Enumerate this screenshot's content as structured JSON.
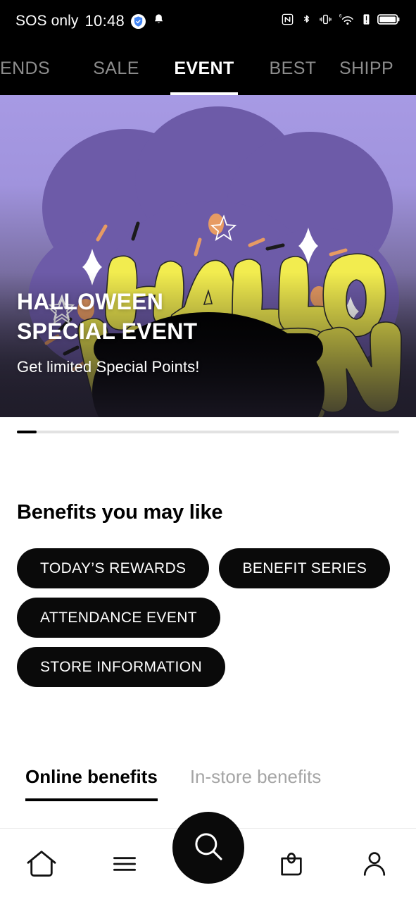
{
  "status_bar": {
    "carrier": "SOS only",
    "time": "10:48",
    "left_icons": [
      "shield-icon",
      "bell-icon"
    ],
    "right_icons": [
      "nfc-icon",
      "bluetooth-icon",
      "vibrate-icon",
      "wifi-6g-icon",
      "signal-alert-icon",
      "battery-icon"
    ]
  },
  "top_tabs": [
    {
      "label": "ENDS",
      "active": false
    },
    {
      "label": "SALE",
      "active": false
    },
    {
      "label": "EVENT",
      "active": true
    },
    {
      "label": "BEST",
      "active": false
    },
    {
      "label": "SHIPP",
      "active": false
    }
  ],
  "banner": {
    "art_text": "HALLOWEEN",
    "art_line1": "HALLO",
    "art_line2": "WEEN",
    "title_line1": "HALLOWEEN",
    "title_line2": "SPECIAL EVENT",
    "subtitle": "Get limited Special Points!",
    "bg_top_color": "#a79ae4",
    "bg_bottom_color": "#2c2839",
    "blob_color": "#6d5ba8",
    "art_fill_color": "#f2ec4f",
    "cauldron_color": "#000000",
    "accent_orange": "#ea9a5e"
  },
  "carousel": {
    "total_width": 543,
    "fill_width": 28,
    "fill_color": "#000000",
    "track_color": "#e2e2e2"
  },
  "benefits": {
    "heading": "Benefits you may like",
    "chips": [
      {
        "label": "TODAY’S REWARDS"
      },
      {
        "label": "BENEFIT SERIES"
      },
      {
        "label": "ATTENDANCE EVENT"
      },
      {
        "label": "STORE INFORMATION"
      }
    ]
  },
  "benefit_tabs": [
    {
      "label": "Online benefits",
      "active": true
    },
    {
      "label": "In-store benefits",
      "active": false
    }
  ],
  "bottom_nav": [
    {
      "name": "home-icon",
      "label": "Home"
    },
    {
      "name": "menu-icon",
      "label": "Menu"
    },
    {
      "name": "search-icon",
      "label": "Search"
    },
    {
      "name": "shopping-bag-icon",
      "label": "Bag"
    },
    {
      "name": "profile-icon",
      "label": "Profile"
    }
  ]
}
